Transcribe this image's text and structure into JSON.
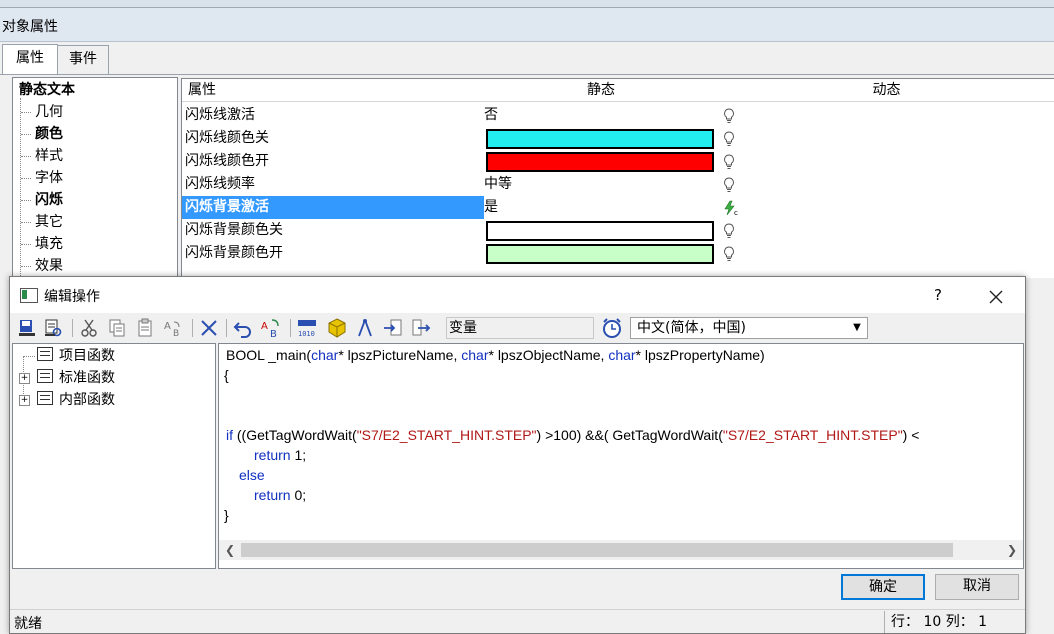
{
  "background_window": {
    "title": "对象属性",
    "tabs": [
      "属性",
      "事件"
    ],
    "tree": {
      "root": "静态文本",
      "children": [
        "几何",
        "颜色",
        "样式",
        "字体",
        "闪烁",
        "其它",
        "填充",
        "效果"
      ],
      "bold_children": [
        "颜色",
        "闪烁"
      ]
    },
    "grid": {
      "headers": {
        "property": "属性",
        "static": "静态",
        "dynamic": "动态"
      },
      "rows": [
        {
          "name": "闪烁线激活",
          "value": "否"
        },
        {
          "name": "闪烁线颜色关",
          "color": "#22eef0"
        },
        {
          "name": "闪烁线颜色开",
          "color": "#ff0000"
        },
        {
          "name": "闪烁线频率",
          "value": "中等"
        },
        {
          "name": "闪烁背景激活",
          "value": "是",
          "selected": true,
          "dynamic_icon": "lightning-icon"
        },
        {
          "name": "闪烁背景颜色关",
          "color": "#ffffff"
        },
        {
          "name": "闪烁背景颜色开",
          "color": "#c8ffc8"
        }
      ]
    }
  },
  "dialog": {
    "title": "编辑操作",
    "help": "?",
    "toolbar": {
      "variable_label": "变量",
      "language": "中文(简体，中国)"
    },
    "function_tree": [
      "项目函数",
      "标准函数",
      "内部函数"
    ],
    "code": {
      "line1": {
        "a": "BOOL _main(",
        "b": "char",
        "c": "* lpszPictureName, ",
        "d": "char",
        "e": "* lpszObjectName, ",
        "f": "char",
        "g": "* lpszPropertyName)"
      },
      "line2": "{",
      "line5": {
        "a": "if",
        "b": " ((GetTagWordWait(",
        "c": "\"S7/E2_START_HINT.STEP\"",
        "d": ") >100) &&( GetTagWordWait(",
        "e": "\"S7/E2_START_HINT.STEP\"",
        "f": ") <"
      },
      "line6": {
        "a": "return",
        "b": " 1;"
      },
      "line7": "else",
      "line8": {
        "a": "return",
        "b": " 0;"
      },
      "line9": "}"
    },
    "ok_label": "确定",
    "cancel_label": "取消",
    "status_text": "就绪",
    "status_position": "行： 10  列： 1"
  }
}
